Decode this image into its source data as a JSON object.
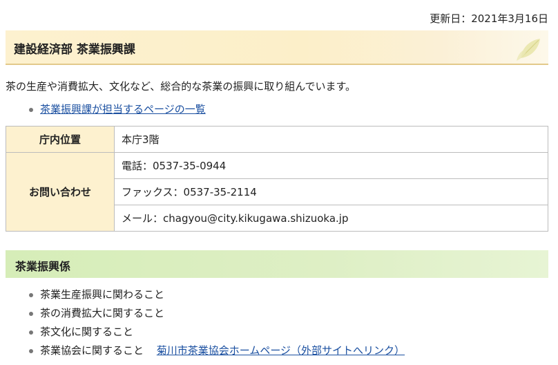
{
  "updated": "更新日：2021年3月16日",
  "dept_title": "建設経済部 茶業振興課",
  "intro": "茶の生産や消費拡大、文化など、総合的な茶業の振興に取り組んでいます。",
  "pages_link": "茶業振興課が担当するページの一覧",
  "contact": {
    "location_label": "庁内位置",
    "location_value": "本庁3階",
    "inquiry_label": "お問い合わせ",
    "phone": "電話：0537-35-0944",
    "fax": "ファックス：0537-35-2114",
    "email": "メール：chagyou@city.kikugawa.shizuoka.jp"
  },
  "section_title": "茶業振興係",
  "duties": [
    "茶業生産振興に関わること",
    "茶の消費拡大に関すること",
    "茶文化に関すること",
    "茶業協会に関すること"
  ],
  "association_link": "菊川市茶業協会ホームページ（外部サイトへリンク）",
  "colors": {
    "header_bg": "#fdf1cf",
    "section_bg": "#d6edb8",
    "link": "#1a4fa0"
  },
  "icons": [
    "tea-leaf-icon",
    "bullet-icon"
  ]
}
